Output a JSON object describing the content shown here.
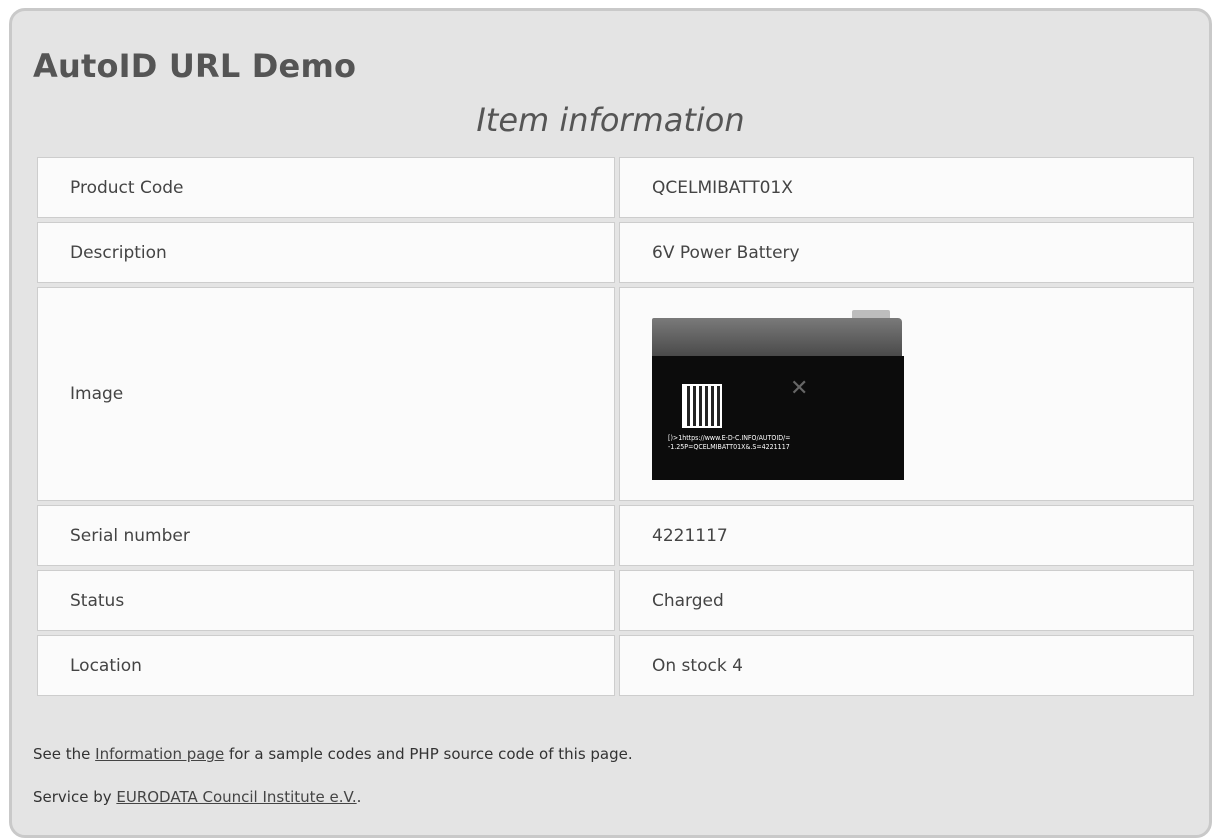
{
  "header": {
    "app_title": "AutoID URL Demo",
    "section_title": "Item information"
  },
  "rows": [
    {
      "label": "Product Code",
      "value": "QCELMIBATT01X"
    },
    {
      "label": "Description",
      "value": "6V Power Battery"
    },
    {
      "label": "Image",
      "value": ""
    },
    {
      "label": "Serial number",
      "value": "4221117"
    },
    {
      "label": "Status",
      "value": "Charged"
    },
    {
      "label": "Location",
      "value": "On stock 4"
    }
  ],
  "image": {
    "alt": "battery-product-photo",
    "label_text_1": "[)>1https://www.E-D-C.INFO/AUTOID/=",
    "label_text_2": "-1.25P=QCELMIBATT01X&.S=4221117"
  },
  "footer": {
    "line1_pre": "See the ",
    "line1_link": "Information page",
    "line1_post": " for a sample codes and PHP source code of this page.",
    "line2_pre": "Service by ",
    "line2_link": "EURODATA Council Institute e.V.",
    "line2_post": "."
  }
}
